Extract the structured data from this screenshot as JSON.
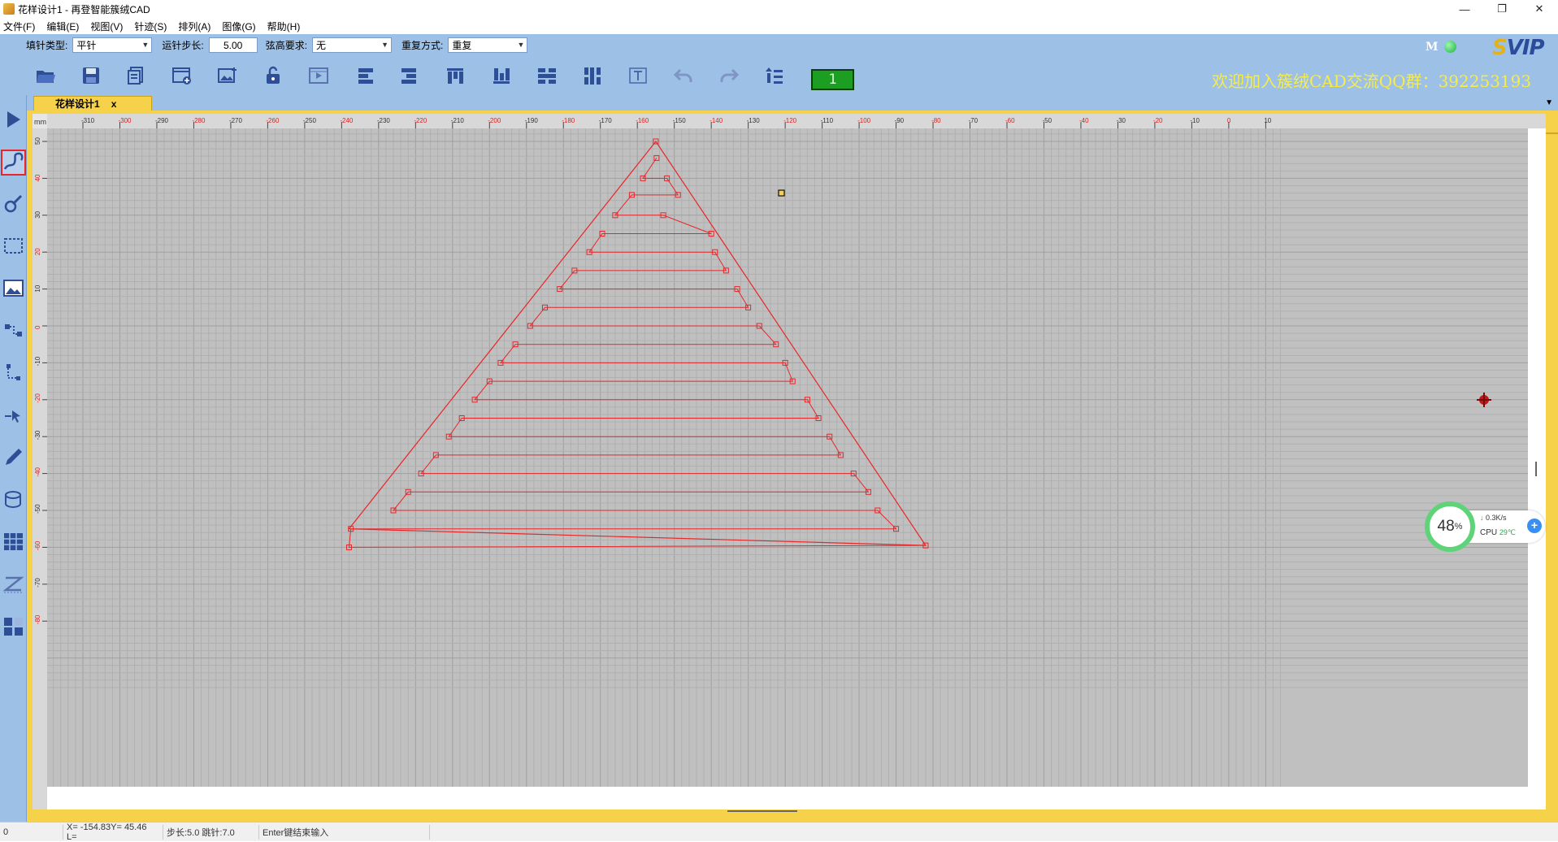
{
  "window": {
    "title": "花样设计1 - 再登智能簇绒CAD",
    "minimize": "—",
    "maximize": "❐",
    "close": "✕"
  },
  "menu": [
    "文件(F)",
    "编辑(E)",
    "视图(V)",
    "针迹(S)",
    "排列(A)",
    "图像(G)",
    "帮助(H)"
  ],
  "props": {
    "fill_type_label": "填针类型:",
    "fill_type_value": "平针",
    "step_label": "运针步长:",
    "step_value": "5.00",
    "chord_label": "弦高要求:",
    "chord_value": "无",
    "repeat_label": "重复方式:",
    "repeat_value": "重复"
  },
  "toolbar": {
    "counter": "1",
    "banner": "欢迎加入簇绒CAD交流QQ群：392253193",
    "logo_s": "S",
    "logo_rest": "VIP",
    "mode": "M",
    "icons": [
      "open-icon",
      "save-icon",
      "copy-doc-icon",
      "new-window-icon",
      "insert-image-icon",
      "unlock-icon",
      "play-icon",
      "align-left-icon",
      "align-right-icon",
      "align-top-icon",
      "align-bottom-icon",
      "distribute-horizontal-icon",
      "distribute-vertical-icon",
      "text-icon",
      "undo-icon",
      "redo-icon",
      "stitch-order-icon"
    ]
  },
  "left_tools": [
    "select-arrow-icon",
    "curve-stitch-icon",
    "stitch-edit-icon",
    "rectangle-select-icon",
    "image-icon",
    "node-edit-icon",
    "corner-icon",
    "pointer-insert-icon",
    "pen-icon",
    "fill-cylinder-icon",
    "grid-icon",
    "z-stitch-icon",
    "tile-blocks-icon"
  ],
  "tab": {
    "label": "花样设计1",
    "close": "x"
  },
  "ruler": {
    "unit": "mm",
    "h_ticks": [
      "-310",
      "-300",
      "-290",
      "-280",
      "-270",
      "-260",
      "-250",
      "-240",
      "-230",
      "-220",
      "-210",
      "-200",
      "-190",
      "-180",
      "-170",
      "-160",
      "-150",
      "-140",
      "-130",
      "-120",
      "-110",
      "-100",
      "-90",
      "-80",
      "-70",
      "-60",
      "-50",
      "-40",
      "-30",
      "-20",
      "-10",
      "0",
      "10"
    ],
    "v_ticks": [
      "50",
      "40",
      "30",
      "20",
      "10",
      "0",
      "-10",
      "-20",
      "-30",
      "-40",
      "-50",
      "-60",
      "-70",
      "-80"
    ]
  },
  "status": {
    "s0": "0",
    "coords": "X= -154.83Y= 45.46  L=",
    "step": "步长:5.0 跳针:7.0",
    "hint": "Enter键结束输入"
  },
  "widget": {
    "percent": "48",
    "percent_sign": "%",
    "speed": "0.3K/s",
    "speed_arrow": "↓",
    "cpu_label": "CPU",
    "cpu_temp": "29℃",
    "plus": "+"
  },
  "colors": {
    "panel": "#9dc0e6",
    "canvas": "#c0c0c0",
    "grid": "#a8a8a8",
    "stitch": "#e8262a",
    "banner": "#f6ec4a",
    "counter_bg": "#1c9e22"
  },
  "design": {
    "outline": [
      [
        -155,
        50
      ],
      [
        -238,
        -55
      ],
      [
        -82,
        -59.5
      ]
    ],
    "stitch_path": [
      [
        -154.8,
        45.5
      ],
      [
        -158.5,
        40
      ],
      [
        -152,
        40
      ],
      [
        -149,
        35.5
      ],
      [
        -161.5,
        35.5
      ],
      [
        -166,
        30
      ],
      [
        -153,
        30
      ],
      [
        -140,
        25
      ],
      [
        -169.5,
        25
      ],
      [
        -173,
        20
      ],
      [
        -139,
        20
      ],
      [
        -136,
        15
      ],
      [
        -177,
        15
      ],
      [
        -181,
        10
      ],
      [
        -133,
        10
      ],
      [
        -130,
        5
      ],
      [
        -185,
        5
      ],
      [
        -189,
        0
      ],
      [
        -127,
        0
      ],
      [
        -122.5,
        -5
      ],
      [
        -193,
        -5
      ],
      [
        -197,
        -10
      ],
      [
        -120,
        -10
      ],
      [
        -118,
        -15
      ],
      [
        -200,
        -15
      ],
      [
        -204,
        -20
      ],
      [
        -114,
        -20
      ],
      [
        -111,
        -25
      ],
      [
        -207.5,
        -25
      ],
      [
        -211,
        -30
      ],
      [
        -108,
        -30
      ],
      [
        -105,
        -35
      ],
      [
        -214.5,
        -35
      ],
      [
        -218.5,
        -40
      ],
      [
        -101.5,
        -40
      ],
      [
        -97.5,
        -45
      ],
      [
        -222,
        -45
      ],
      [
        -226,
        -50
      ],
      [
        -95,
        -50
      ],
      [
        -90,
        -55
      ],
      [
        -237.5,
        -55
      ],
      [
        -238,
        -60
      ],
      [
        -82,
        -59.5
      ]
    ]
  }
}
